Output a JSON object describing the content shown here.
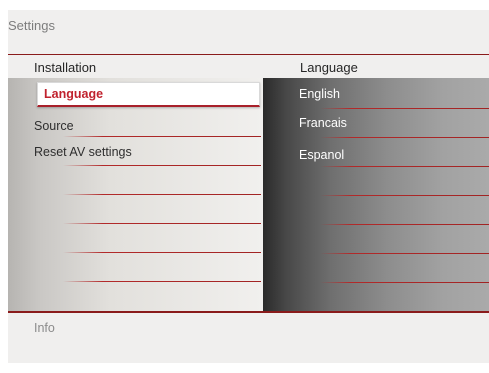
{
  "window": {
    "title": "Settings"
  },
  "columns": {
    "left_header": "Installation",
    "right_header": "Language"
  },
  "menu": {
    "selected_label": "Language",
    "items": [
      "Source",
      "Reset AV settings"
    ]
  },
  "options": [
    "English",
    "Francais",
    "Espanol"
  ],
  "footer": {
    "info_label": "Info"
  },
  "colors": {
    "accent": "#c0222e",
    "divider": "#8a1b1b"
  }
}
